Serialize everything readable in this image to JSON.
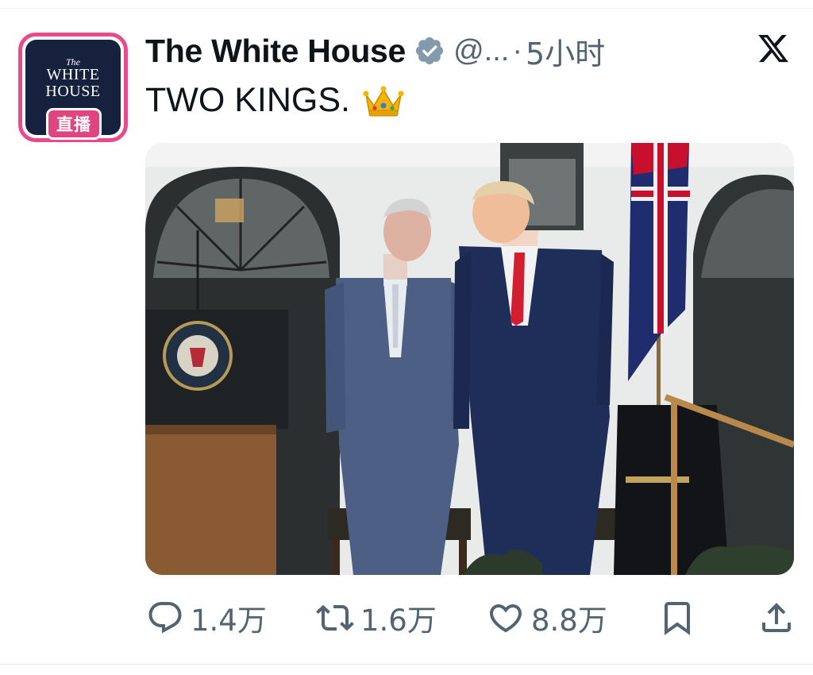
{
  "account": {
    "display_name": "The White House",
    "handle": "@...",
    "separator": "·",
    "time_ago": "5小时",
    "avatar": {
      "line1": "The",
      "line2": "WHITE",
      "line3": "HOUSE",
      "live_badge": "直播"
    }
  },
  "tweet": {
    "text": "TWO KINGS."
  },
  "icons": {
    "verified": "verified-badge-icon",
    "close": "x-logo-icon",
    "emoji": "crown-emoji-icon",
    "reply": "reply-icon",
    "retweet": "retweet-icon",
    "like": "heart-icon",
    "bookmark": "bookmark-icon",
    "share": "share-icon"
  },
  "actions": {
    "replies": "1.4万",
    "retweets": "1.6万",
    "likes": "8.8万"
  },
  "colors": {
    "avatar_border": "#e84a8c",
    "avatar_bg": "#16213e",
    "verified": "#829aab",
    "text": "#0f1419",
    "secondary": "#536471"
  }
}
